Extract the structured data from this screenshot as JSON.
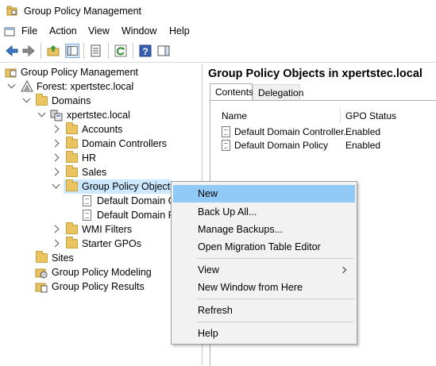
{
  "window": {
    "title": "Group Policy Management"
  },
  "menubar": {
    "items": [
      "File",
      "Action",
      "View",
      "Window",
      "Help"
    ]
  },
  "toolbar": {
    "icons": [
      "back-icon",
      "forward-icon",
      "up-folder-icon",
      "show-hide-tree-icon",
      "properties-icon",
      "refresh-icon",
      "help-icon",
      "action-pane-icon"
    ]
  },
  "tree": {
    "root": "Group Policy Management",
    "forest": "Forest: xpertstec.local",
    "domains": "Domains",
    "domain": "xpertstec.local",
    "accounts": "Accounts",
    "domain_controllers": "Domain Controllers",
    "hr": "HR",
    "sales": "Sales",
    "gpo": "Group Policy Objects",
    "gpo_child_1": "Default Domain C",
    "gpo_child_2": "Default Domain P",
    "wmi": "WMI Filters",
    "starter": "Starter GPOs",
    "sites": "Sites",
    "modeling": "Group Policy Modeling",
    "results": "Group Policy Results"
  },
  "right": {
    "title": "Group Policy Objects in xpertstec.local",
    "tabs": [
      "Contents",
      "Delegation"
    ],
    "columns": [
      "Name",
      "GPO Status"
    ],
    "rows": [
      {
        "name": "Default Domain Controller...",
        "status": "Enabled"
      },
      {
        "name": "Default Domain Policy",
        "status": "Enabled"
      }
    ]
  },
  "context_menu": {
    "new": "New",
    "backup": "Back Up All...",
    "manage": "Manage Backups...",
    "migration": "Open Migration Table Editor",
    "view": "View",
    "new_window": "New Window from Here",
    "refresh": "Refresh",
    "help": "Help"
  },
  "colors": {
    "highlight": "#91c9f7",
    "selected_tree": "#cce8ff",
    "folder": "#e9c460"
  }
}
